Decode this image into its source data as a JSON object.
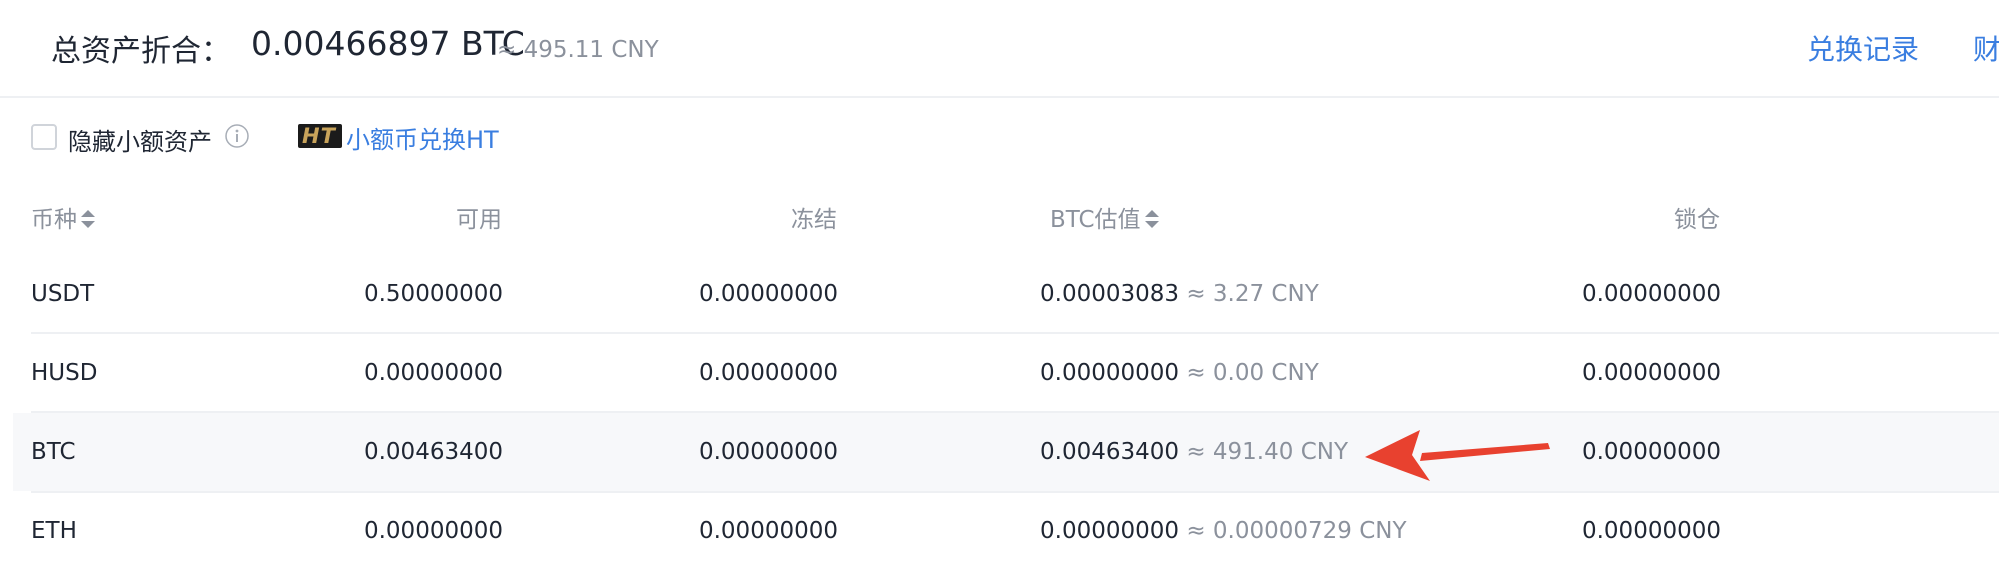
{
  "header": {
    "total_label": "总资产折合：",
    "total_value": "0.00466897 BTC",
    "total_approx": "≈ 495.11 CNY",
    "links": [
      "兑换记录",
      "财"
    ]
  },
  "filters": {
    "hide_small_label": "隐藏小额资产",
    "ht_badge": "HT",
    "convert_link": "小额币兑换HT"
  },
  "table": {
    "columns": [
      "币种",
      "可用",
      "冻结",
      "BTC估值",
      "锁仓"
    ],
    "rows": [
      {
        "coin": "USDT",
        "available": "0.50000000",
        "frozen": "0.00000000",
        "btc_value": "0.00003083",
        "cny": "≈ 3.27 CNY",
        "locked": "0.00000000"
      },
      {
        "coin": "HUSD",
        "available": "0.00000000",
        "frozen": "0.00000000",
        "btc_value": "0.00000000",
        "cny": "≈ 0.00 CNY",
        "locked": "0.00000000"
      },
      {
        "coin": "BTC",
        "available": "0.00463400",
        "frozen": "0.00000000",
        "btc_value": "0.00463400",
        "cny": "≈ 491.40 CNY",
        "locked": "0.00000000"
      },
      {
        "coin": "ETH",
        "available": "0.00000000",
        "frozen": "0.00000000",
        "btc_value": "0.00000000",
        "cny": "≈ 0.00000729 CNY",
        "locked": "0.00000000"
      }
    ]
  },
  "colors": {
    "link": "#3a7ee0",
    "muted": "#8b919c",
    "text": "#1f2633",
    "annotation_arrow": "#e8412f"
  },
  "icons": {
    "info": "info-icon",
    "sort": "sort-icon",
    "annotation": "red-arrow-annotation"
  }
}
